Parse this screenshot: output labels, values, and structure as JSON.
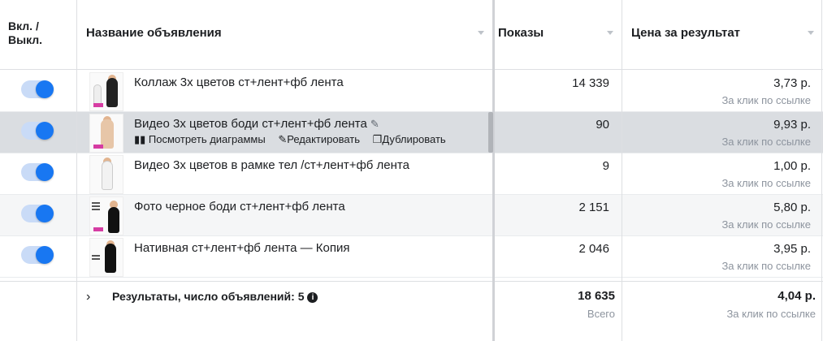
{
  "header": {
    "toggle_col_line1": "Вкл. /",
    "toggle_col_line2": "Выкл.",
    "name_col": "Название объявления",
    "impressions_col": "Показы",
    "cpr_col": "Цена за результат"
  },
  "rows": [
    {
      "name": "Коллаж 3х цветов ст+лент+фб лента",
      "impressions": "14 339",
      "price": "3,73 р.",
      "price_sub": "За клик по ссылке",
      "enabled": true
    },
    {
      "name": "Видео 3х цветов боди ст+лент+фб лента",
      "impressions": "90",
      "price": "9,93 р.",
      "price_sub": "За клик по ссылке",
      "enabled": true,
      "actions": {
        "view_charts": "Посмотреть диаграммы",
        "edit": "Редактировать",
        "duplicate": "Дублировать"
      }
    },
    {
      "name": "Видео 3х цветов в рамке тел /ст+лент+фб лента",
      "impressions": "9",
      "price": "1,00 р.",
      "price_sub": "За клик по ссылке",
      "enabled": true
    },
    {
      "name": "Фото черное боди ст+лент+фб лента",
      "impressions": "2 151",
      "price": "5,80 р.",
      "price_sub": "За клик по ссылке",
      "enabled": true
    },
    {
      "name": "Нативная ст+лент+фб лента — Копия",
      "impressions": "2 046",
      "price": "3,95 р.",
      "price_sub": "За клик по ссылке",
      "enabled": true
    }
  ],
  "summary": {
    "label": "Результаты, число объявлений: 5",
    "impressions": "18 635",
    "impressions_sub": "Всего",
    "price": "4,04 р.",
    "price_sub": "За клик по ссылке"
  },
  "colors": {
    "toggle_on": "#1877f2",
    "row_hover": "#dadde1",
    "muted_text": "#8d949e"
  },
  "icons": [
    "sort-caret-icon",
    "bar-chart-icon",
    "pencil-icon",
    "duplicate-icon",
    "chevron-right-icon",
    "info-icon"
  ]
}
